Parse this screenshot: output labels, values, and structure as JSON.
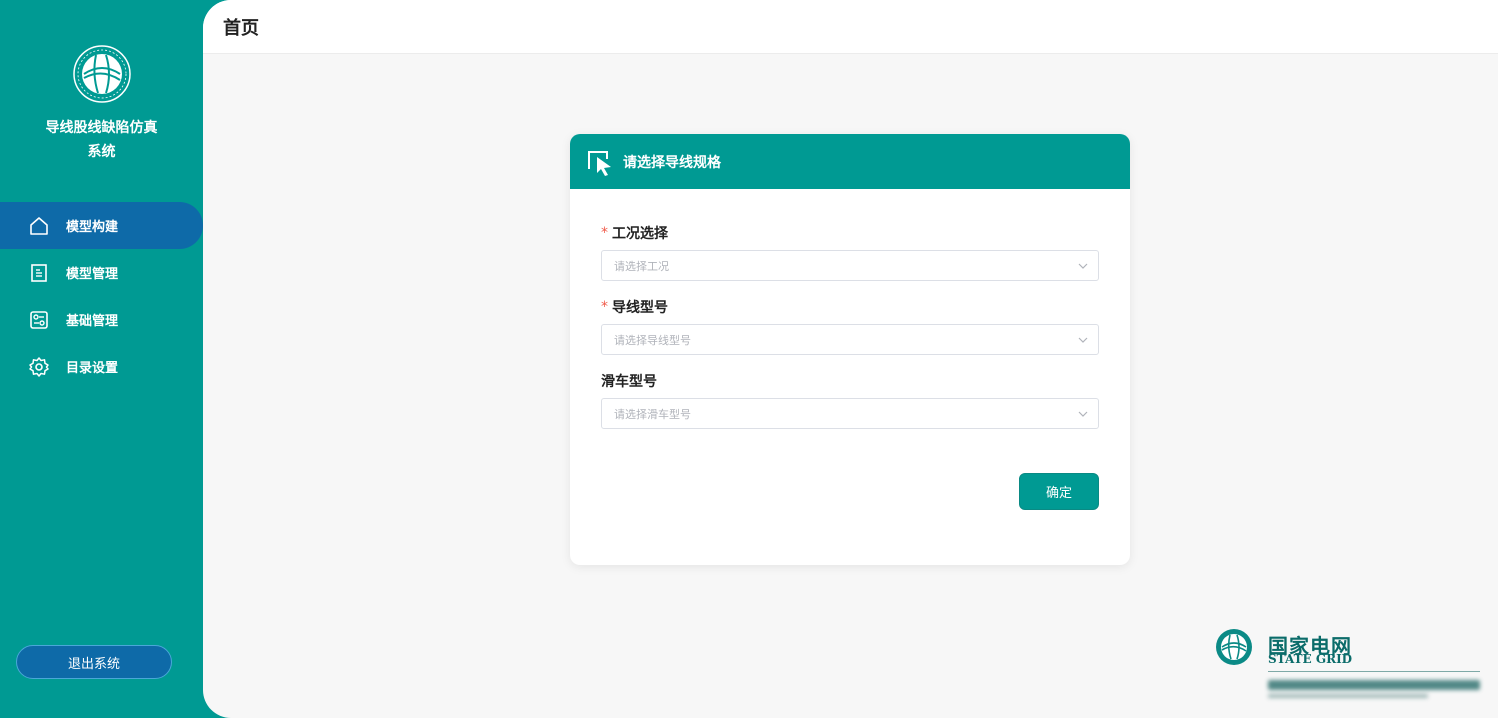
{
  "sidebar": {
    "app_title": "导线股线缺陷仿真系统",
    "items": [
      {
        "label": "模型构建",
        "icon": "home-icon",
        "active": true
      },
      {
        "label": "模型管理",
        "icon": "document-icon",
        "active": false
      },
      {
        "label": "基础管理",
        "icon": "settings-panel-icon",
        "active": false
      },
      {
        "label": "目录设置",
        "icon": "gear-icon",
        "active": false
      }
    ],
    "logout_label": "退出系统"
  },
  "header": {
    "title": "首页"
  },
  "card": {
    "title": "请选择导线规格",
    "fields": [
      {
        "label": "工况选择",
        "required": true,
        "placeholder": "请选择工况"
      },
      {
        "label": "导线型号",
        "required": true,
        "placeholder": "请选择导线型号"
      },
      {
        "label": "滑车型号",
        "required": false,
        "placeholder": "请选择滑车型号"
      }
    ],
    "required_mark": "*",
    "confirm_label": "确定"
  },
  "brand": {
    "name_cn": "国家电网",
    "name_en": "STATE GRID"
  },
  "colors": {
    "primary": "#009a93",
    "active_nav": "#0e6aa8",
    "required": "#f05a4a"
  }
}
